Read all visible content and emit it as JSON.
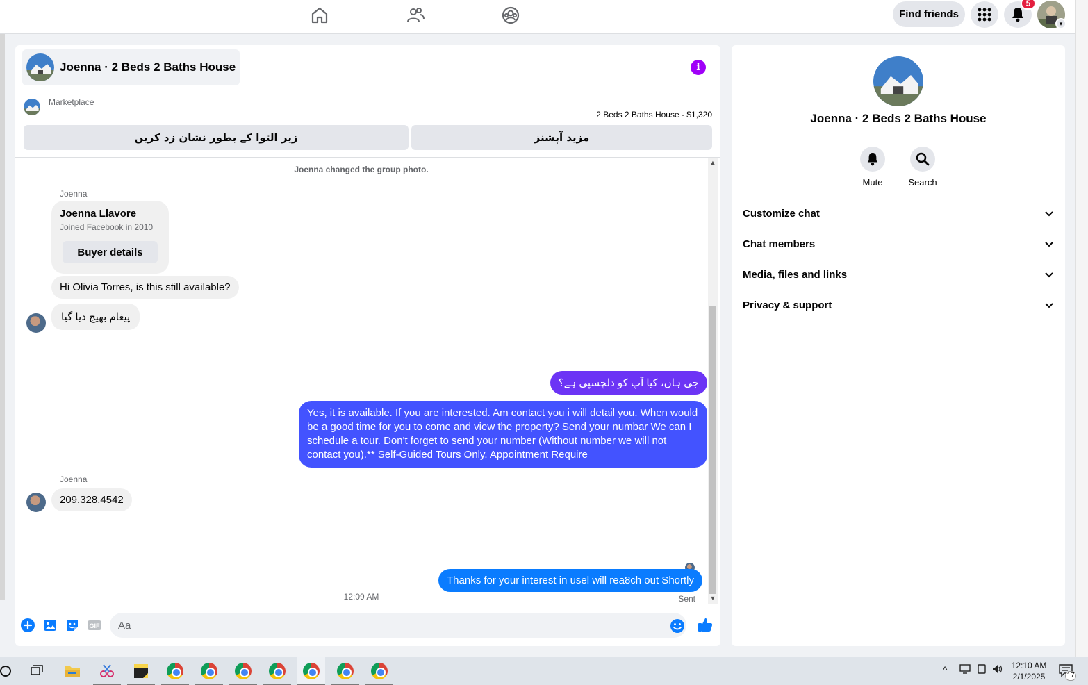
{
  "topbar": {
    "find_friends_label": "Find friends",
    "notification_count": "5",
    "icons": [
      "home-icon",
      "friends-icon",
      "groups-icon",
      "apps-grid-icon",
      "bell-icon"
    ]
  },
  "chat": {
    "title": "Joenna · 2 Beds 2 Baths House",
    "marketplace_label": "Marketplace",
    "listing_price": "2 Beds 2 Baths House - $1,320",
    "action_mark_pending": "زیر التوا کے بطور نشان زد کریں",
    "action_more_options": "مزید آپشنز",
    "system_message": "Joenna changed the group photo.",
    "sender_name_1": "Joenna",
    "card_name": "Joenna Llavore",
    "card_sub": "Joined Facebook in 2010",
    "card_button": "Buyer details",
    "msg_in_1": "Hi Olivia Torres, is this still available?",
    "msg_in_2": "پیغام بھیج دیا گیا",
    "msg_out_1": "جی ہاں، کیا آپ کو دلچسپی ہے؟",
    "msg_out_2": "Yes, it is available. If you are interested.  Am contact you i will detail you.  When would be a good time for you to come and view the property? Send your numbar We can I schedule a tour.  Don't forget to send your number (Without number we will not contact you).** Self-Guided Tours Only. Appointment Require",
    "sender_name_2": "Joenna",
    "msg_in_3": "209.328.4542",
    "timestamp": "12:09 AM",
    "msg_out_3": "Thanks for your interest in usel will rea8ch out Shortly",
    "sent_label": "Sent",
    "composer_placeholder": "Aa",
    "colors": {
      "outgoing_top": "#7b2ff7",
      "outgoing_mid": "#4353ff",
      "outgoing_bottom": "#0a7cff",
      "incoming": "#f0f0f0",
      "info": "#a000f8",
      "accent": "#0a7cff"
    }
  },
  "details": {
    "title": "Joenna · 2 Beds 2 Baths House",
    "mute_label": "Mute",
    "search_label": "Search",
    "rows": [
      "Customize chat",
      "Chat members",
      "Media, files and links",
      "Privacy & support"
    ]
  },
  "taskbar": {
    "time": "12:10 AM",
    "date": "2/1/2025",
    "notification_count": "17"
  }
}
